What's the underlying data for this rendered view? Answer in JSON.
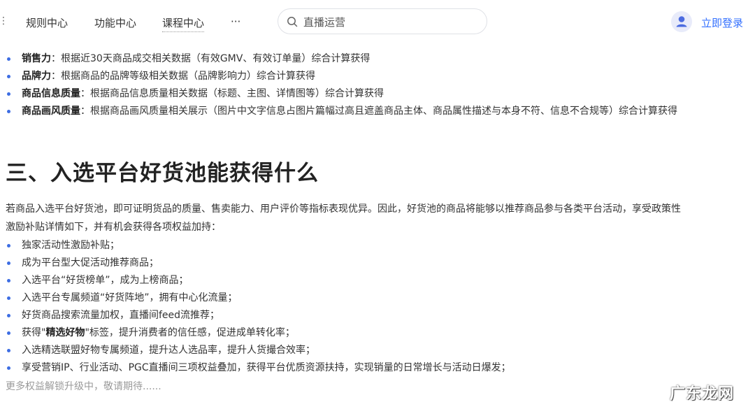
{
  "header": {
    "nav_items": [
      "规则中心",
      "功能中心",
      "课程中心",
      "···"
    ],
    "search": {
      "placeholder": "直播运营"
    },
    "login_label": "立即登录"
  },
  "top_bullets": [
    {
      "bold": "销售力",
      "text": "：根据近30天商品成交相关数据（有效GMV、有效订单量）综合计算获得"
    },
    {
      "bold": "品牌力",
      "text": "：根据商品的品牌等级相关数据（品牌影响力）综合计算获得"
    },
    {
      "bold": "商品信息质量",
      "text": "：根据商品信息质量相关数据（标题、主图、详情图等）综合计算获得"
    },
    {
      "bold": "商品画风质量",
      "text": "：根据商品画风质量相关展示（图片中文字信息占图片篇幅过高且遮盖商品主体、商品属性描述与本身不符、信息不合规等）综合计算获得"
    }
  ],
  "section": {
    "heading": "三、入选平台好货池能获得什么",
    "intro_line1": "若商品入选平台好货池，即可证明货品的质量、售卖能力、用户评价等指标表现优异。因此，好货池的商品将能够以推荐商品参与各类平台活动，享受政策性",
    "intro_line2": "激励补贴详情如下，并有机会获得各项权益加持：",
    "benefits": [
      "独家活动性激励补贴；",
      "成为平台型大促活动推荐商品；",
      "入选平台“好货榜单”，成为上榜商品；",
      "入选平台专属频道“好货阵地”，拥有中心化流量；",
      "好货商品搜索流量加权，直播间feed流推荐；"
    ],
    "benefit_special": {
      "before": "获得\"",
      "bold": "精选好物",
      "after": "\"标签，提升消费者的信任感，促进成单转化率；"
    },
    "benefits_after": [
      "入选精选联盟好物专属频道，提升达人选品率，提升人货撮合效率；",
      "享受营销IP、行业活动、PGC直播间三项权益叠加，获得平台优质资源扶持，实现销量的日常增长与活动日爆发；"
    ],
    "more_text": "更多权益解锁升级中，敬请期待......"
  },
  "watermark": "广东龙网",
  "colors": {
    "accent": "#3370ff",
    "bullet": "#3d6de3"
  }
}
